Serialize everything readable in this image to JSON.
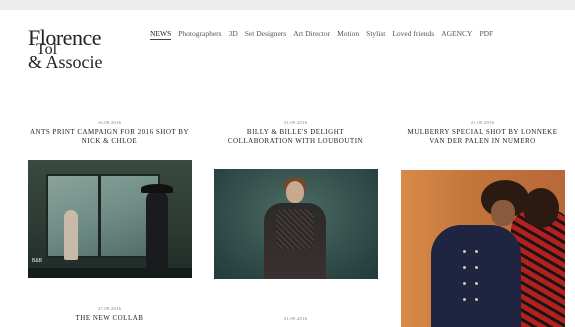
{
  "logo": {
    "line1": "Florence",
    "line2": "Tol",
    "line3": "& Associe"
  },
  "nav": [
    {
      "label": "NEWS",
      "active": true
    },
    {
      "label": "Photographers"
    },
    {
      "label": "3D"
    },
    {
      "label": "Set Designers"
    },
    {
      "label": "Art Director"
    },
    {
      "label": "Motion"
    },
    {
      "label": "Stylist"
    },
    {
      "label": "Loved friends"
    },
    {
      "label": "AGENCY"
    },
    {
      "label": "PDF"
    }
  ],
  "posts": [
    {
      "date": "16.09.2016",
      "title": "ANTS PRINT CAMPAIGN FOR 2016 SHOT BY NICK & CHLOE",
      "sign": "B&B"
    },
    {
      "date": "21.09.2016",
      "title": "BILLY & BILLE'S DELIGHT COLLABORATION WITH LOUBOUTIN"
    },
    {
      "date": "21.09.2016",
      "title": "MULBERRY SPECIAL SHOT BY LONNEKE VAN DER PALEN IN NUMERO"
    },
    {
      "date": "27.09.2016",
      "title": "THE NEW COLLAB"
    },
    {
      "date": "21.09.2016"
    }
  ]
}
